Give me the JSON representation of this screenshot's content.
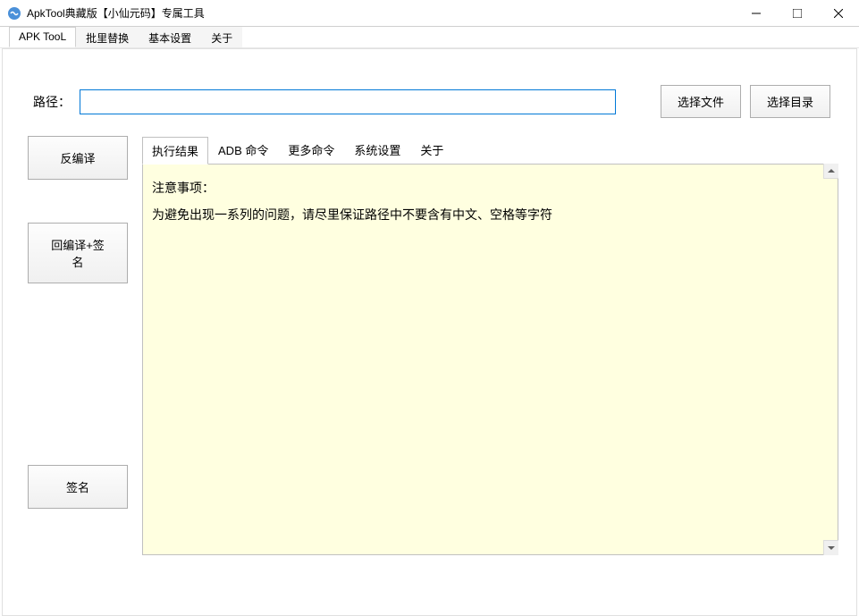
{
  "window": {
    "title": "ApkTool典藏版【小仙元码】专属工具"
  },
  "main_tabs": {
    "apk_tool": "APK TooL",
    "batch_replace": "批里替换",
    "basic_settings": "基本设置",
    "about": "关于"
  },
  "path_section": {
    "label": "路径：",
    "value": "",
    "select_file": "选择文件",
    "select_dir": "选择目录"
  },
  "side_actions": {
    "decompile": "反编译",
    "recompile_sign": "回编译+签名",
    "sign": "签名"
  },
  "inner_tabs": {
    "execute_result": "执行结果",
    "adb_commands": "ADB 命令",
    "more_commands": "更多命令",
    "system_settings": "系统设置",
    "about": "关于"
  },
  "result": {
    "line1": "注意事项：",
    "line2": "为避免出现一系列的问题，请尽里保证路径中不要含有中文、空格等字符"
  }
}
